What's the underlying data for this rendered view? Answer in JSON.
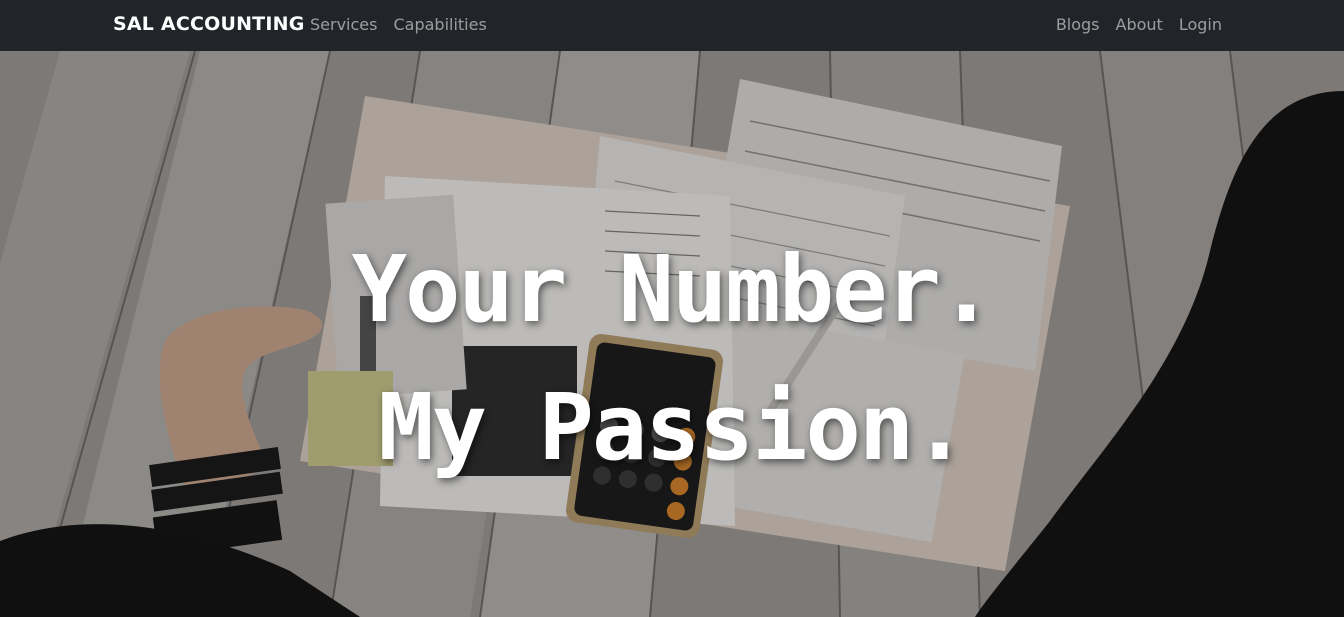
{
  "navbar": {
    "brand": "SAL ACCOUNTING",
    "left_links": [
      "Services",
      "Capabilities"
    ],
    "right_links": [
      "Blogs",
      "About",
      "Login"
    ]
  },
  "hero": {
    "line1": "Your Number.",
    "line2": "My Passion."
  },
  "colors": {
    "navbar_bg": "#212529",
    "brand_text": "#ffffff",
    "nav_link": "rgba(255,255,255,0.55)",
    "headline": "#ffffff"
  }
}
